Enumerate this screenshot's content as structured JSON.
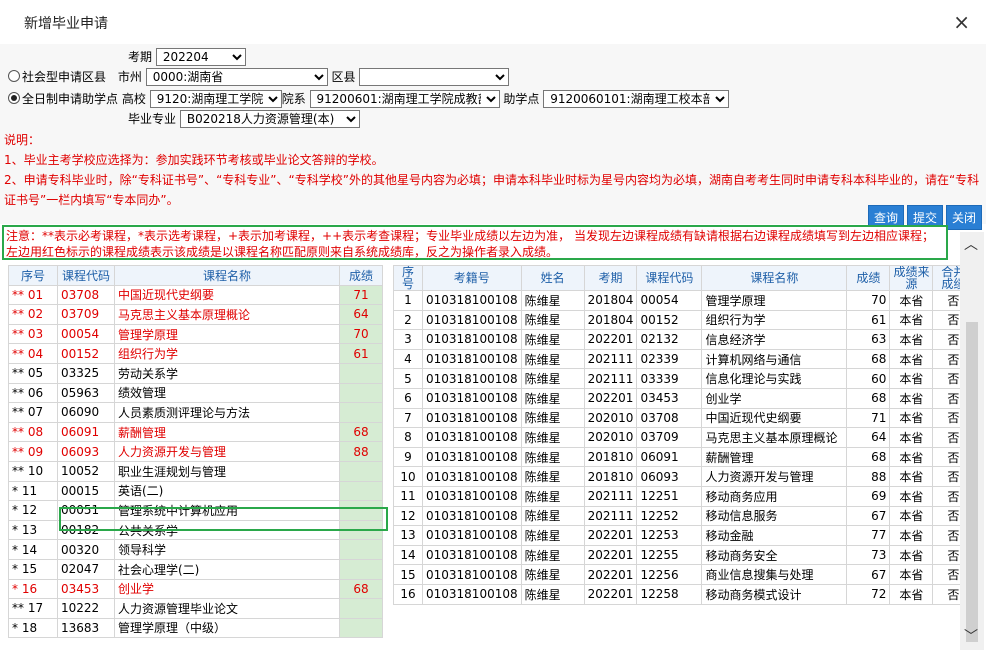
{
  "dialog": {
    "title": "新增毕业申请",
    "close": "×"
  },
  "form": {
    "kaoqi_label": "考期",
    "kaoqi_value": "202204",
    "opt1_label": "社会型申请区县",
    "shizhou_label": "市州",
    "shizhou_value": "0000:湖南省",
    "quxian_label": "区县",
    "quxian_value": "",
    "opt2_label": "全日制申请助学点",
    "gaoxiao_label": "高校",
    "gaoxiao_value": "9120:湖南理工学院",
    "yuanxi_label": "院系",
    "yuanxi_value": "91200601:湖南理工学院成教部",
    "zhuxue_label": "助学点",
    "zhuxue_value": "9120060101:湖南理工校本部",
    "zhuanye_label": "毕业专业",
    "zhuanye_value": "B020218人力资源管理(本)"
  },
  "notes": {
    "title": "说明：",
    "line1": "1、毕业主考学校应选择为：参加实践环节考核或毕业论文答辩的学校。",
    "line2": "2、申请专科毕业时，除“专科证书号”、“专科专业”、“专科学校”外的其他星号内容为必填；申请本科毕业时标为星号内容均为必填，湖南自考考生同时申请专科本科毕业的，请在“专科证书号”一栏内填写“专本同办”。"
  },
  "buttons": {
    "query": "查询",
    "submit": "提交",
    "close": "关闭"
  },
  "legend": "注意：**表示必考课程，*表示选考课程，+表示加考课程，++表示考查课程；专业毕业成绩以左边为准， 当发现左边课程成绩有缺请根据右边课程成绩填写到左边相应课程；左边用红色标示的课程成绩表示该成绩是以课程名称匹配原则来自系统成绩库，反之为操作者录入成绩。",
  "left_table": {
    "headers": [
      "序号",
      "课程代码",
      "课程名称",
      "成绩"
    ],
    "rows": [
      {
        "no": "** 01",
        "code": "03708",
        "name": "中国近现代史纲要",
        "score": "71",
        "red": true
      },
      {
        "no": "** 02",
        "code": "03709",
        "name": "马克思主义基本原理概论",
        "score": "64",
        "red": true
      },
      {
        "no": "** 03",
        "code": "00054",
        "name": "管理学原理",
        "score": "70",
        "red": true
      },
      {
        "no": "** 04",
        "code": "00152",
        "name": "组织行为学",
        "score": "61",
        "red": true
      },
      {
        "no": "** 05",
        "code": "03325",
        "name": "劳动关系学",
        "score": "",
        "red": false
      },
      {
        "no": "** 06",
        "code": "05963",
        "name": "绩效管理",
        "score": "",
        "red": false
      },
      {
        "no": "** 07",
        "code": "06090",
        "name": "人员素质测评理论与方法",
        "score": "",
        "red": false
      },
      {
        "no": "** 08",
        "code": "06091",
        "name": "薪酬管理",
        "score": "68",
        "red": true
      },
      {
        "no": "** 09",
        "code": "06093",
        "name": "人力资源开发与管理",
        "score": "88",
        "red": true
      },
      {
        "no": "** 10",
        "code": "10052",
        "name": "职业生涯规划与管理",
        "score": "",
        "red": false
      },
      {
        "no": "* 11",
        "code": "00015",
        "name": "英语(二)",
        "score": "",
        "red": false
      },
      {
        "no": "* 12",
        "code": "00051",
        "name": "管理系统中计算机应用",
        "score": "",
        "red": false
      },
      {
        "no": "* 13",
        "code": "00182",
        "name": "公共关系学",
        "score": "",
        "red": false
      },
      {
        "no": "* 14",
        "code": "00320",
        "name": "领导科学",
        "score": "",
        "red": false
      },
      {
        "no": "* 15",
        "code": "02047",
        "name": "社会心理学(二)",
        "score": "",
        "red": false
      },
      {
        "no": "* 16",
        "code": "03453",
        "name": "创业学",
        "score": "68",
        "red": true
      },
      {
        "no": "** 17",
        "code": "10222",
        "name": "人力资源管理毕业论文",
        "score": "",
        "red": false
      },
      {
        "no": "* 18",
        "code": "13683",
        "name": "管理学原理（中级）",
        "score": "",
        "red": false
      }
    ]
  },
  "right_table": {
    "headers": [
      "序号",
      "考籍号",
      "姓名",
      "考期",
      "课程代码",
      "课程名称",
      "成绩",
      "成绩来源",
      "合并成绩"
    ],
    "rows": [
      {
        "no": "1",
        "id": "010318100108",
        "name": "陈维星",
        "term": "201804",
        "code": "00054",
        "course": "管理学原理",
        "score": "70",
        "src": "本省",
        "merge": "否"
      },
      {
        "no": "2",
        "id": "010318100108",
        "name": "陈维星",
        "term": "201804",
        "code": "00152",
        "course": "组织行为学",
        "score": "61",
        "src": "本省",
        "merge": "否"
      },
      {
        "no": "3",
        "id": "010318100108",
        "name": "陈维星",
        "term": "202201",
        "code": "02132",
        "course": "信息经济学",
        "score": "63",
        "src": "本省",
        "merge": "否"
      },
      {
        "no": "4",
        "id": "010318100108",
        "name": "陈维星",
        "term": "202111",
        "code": "02339",
        "course": "计算机网络与通信",
        "score": "68",
        "src": "本省",
        "merge": "否"
      },
      {
        "no": "5",
        "id": "010318100108",
        "name": "陈维星",
        "term": "202111",
        "code": "03339",
        "course": "信息化理论与实践",
        "score": "60",
        "src": "本省",
        "merge": "否"
      },
      {
        "no": "6",
        "id": "010318100108",
        "name": "陈维星",
        "term": "202201",
        "code": "03453",
        "course": "创业学",
        "score": "68",
        "src": "本省",
        "merge": "否"
      },
      {
        "no": "7",
        "id": "010318100108",
        "name": "陈维星",
        "term": "202010",
        "code": "03708",
        "course": "中国近现代史纲要",
        "score": "71",
        "src": "本省",
        "merge": "否"
      },
      {
        "no": "8",
        "id": "010318100108",
        "name": "陈维星",
        "term": "202010",
        "code": "03709",
        "course": "马克思主义基本原理概论",
        "score": "64",
        "src": "本省",
        "merge": "否"
      },
      {
        "no": "9",
        "id": "010318100108",
        "name": "陈维星",
        "term": "201810",
        "code": "06091",
        "course": "薪酬管理",
        "score": "68",
        "src": "本省",
        "merge": "否"
      },
      {
        "no": "10",
        "id": "010318100108",
        "name": "陈维星",
        "term": "201810",
        "code": "06093",
        "course": "人力资源开发与管理",
        "score": "88",
        "src": "本省",
        "merge": "否"
      },
      {
        "no": "11",
        "id": "010318100108",
        "name": "陈维星",
        "term": "202111",
        "code": "12251",
        "course": "移动商务应用",
        "score": "69",
        "src": "本省",
        "merge": "否"
      },
      {
        "no": "12",
        "id": "010318100108",
        "name": "陈维星",
        "term": "202111",
        "code": "12252",
        "course": "移动信息服务",
        "score": "67",
        "src": "本省",
        "merge": "否"
      },
      {
        "no": "13",
        "id": "010318100108",
        "name": "陈维星",
        "term": "202201",
        "code": "12253",
        "course": "移动金融",
        "score": "77",
        "src": "本省",
        "merge": "否"
      },
      {
        "no": "14",
        "id": "010318100108",
        "name": "陈维星",
        "term": "202201",
        "code": "12255",
        "course": "移动商务安全",
        "score": "73",
        "src": "本省",
        "merge": "否"
      },
      {
        "no": "15",
        "id": "010318100108",
        "name": "陈维星",
        "term": "202201",
        "code": "12256",
        "course": "商业信息搜集与处理",
        "score": "67",
        "src": "本省",
        "merge": "否"
      },
      {
        "no": "16",
        "id": "010318100108",
        "name": "陈维星",
        "term": "202201",
        "code": "12258",
        "course": "移动商务模式设计",
        "score": "72",
        "src": "本省",
        "merge": "否"
      }
    ]
  }
}
